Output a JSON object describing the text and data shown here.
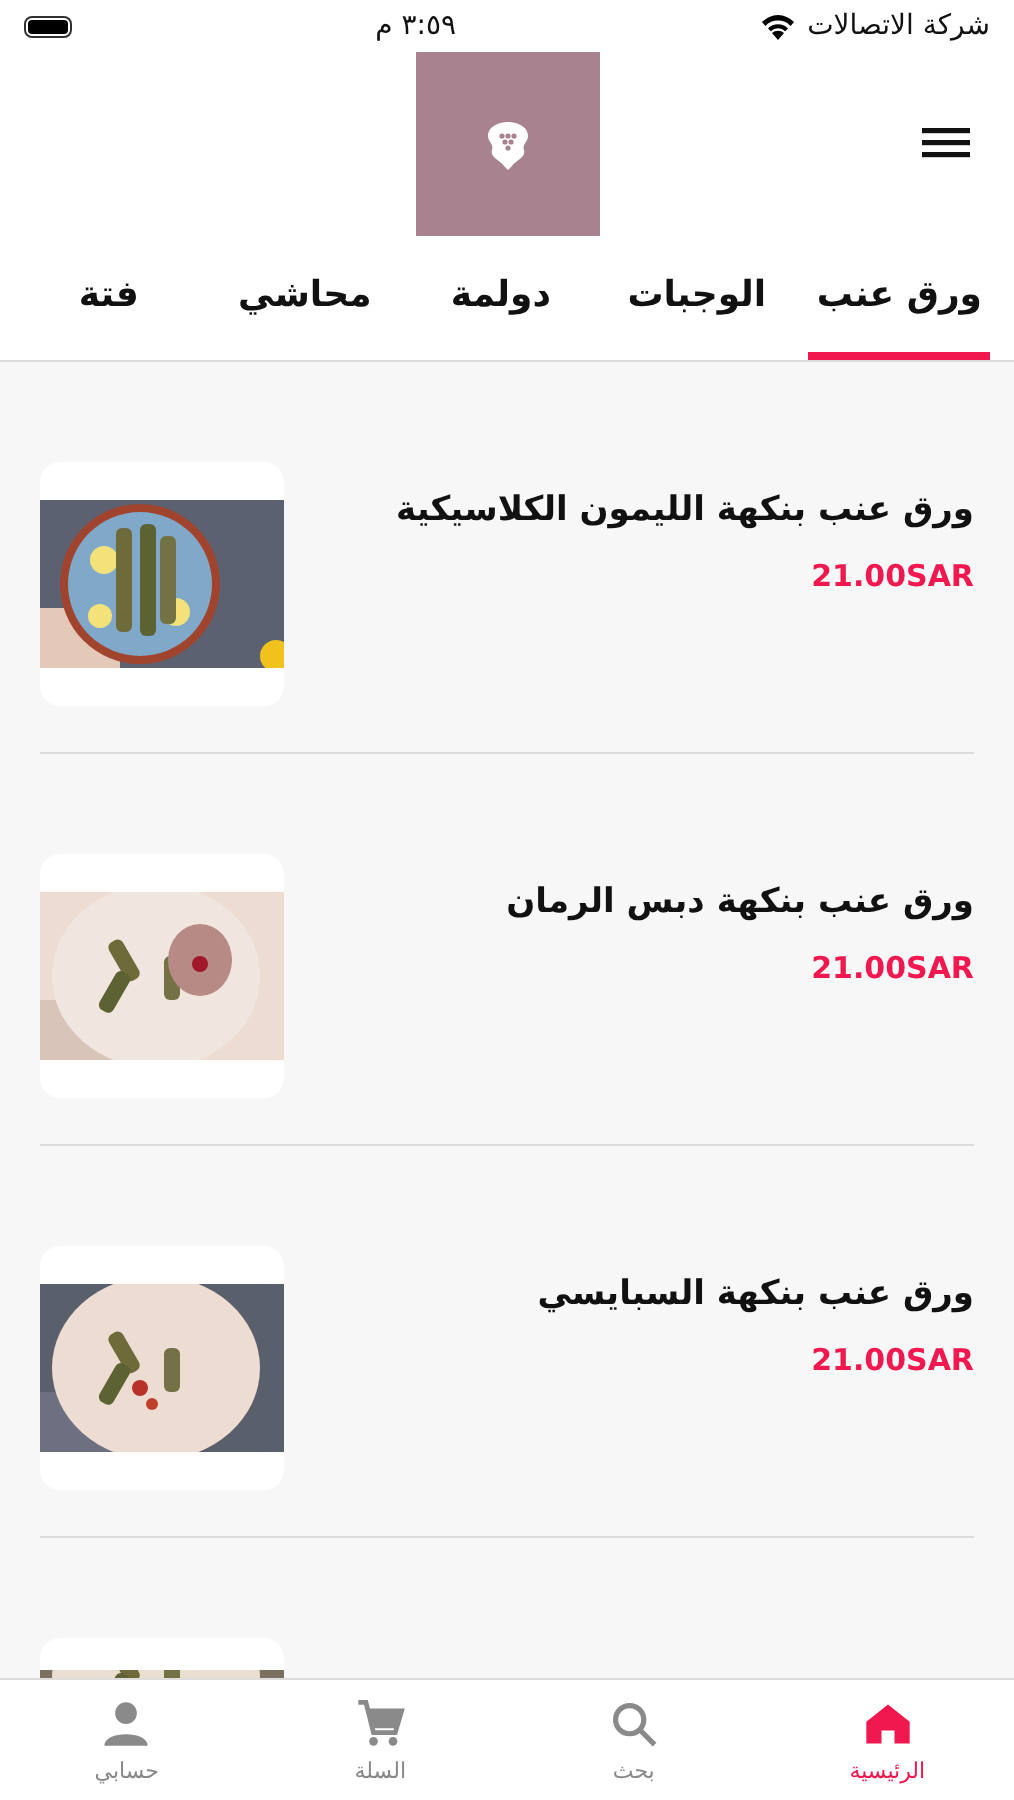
{
  "status_bar": {
    "carrier": "شركة الاتصالات",
    "time": "٣:٥٩ م"
  },
  "tabs": [
    {
      "label": "ورق عنب",
      "selected": true
    },
    {
      "label": "الوجبات",
      "selected": false
    },
    {
      "label": "دولمة",
      "selected": false
    },
    {
      "label": "محاشي",
      "selected": false
    },
    {
      "label": "فتة",
      "selected": false
    }
  ],
  "items": [
    {
      "kind": "dish",
      "title": "ورق عنب بنكهة الليمون الكلاسيكية",
      "price": "21.00SAR"
    },
    {
      "kind": "dish",
      "title": "ورق عنب بنكهة دبس الرمان",
      "price": "21.00SAR"
    },
    {
      "kind": "dish",
      "title": "ورق عنب بنكهة السبايسي",
      "price": "21.00SAR"
    },
    {
      "kind": "partial"
    }
  ],
  "bottom_nav": [
    {
      "label": "الرئيسية",
      "kind": "home",
      "selected": true
    },
    {
      "label": "بحث",
      "kind": "search",
      "selected": false
    },
    {
      "label": "السلة",
      "kind": "cart",
      "selected": false
    },
    {
      "label": "حسابي",
      "kind": "person",
      "selected": false
    }
  ]
}
